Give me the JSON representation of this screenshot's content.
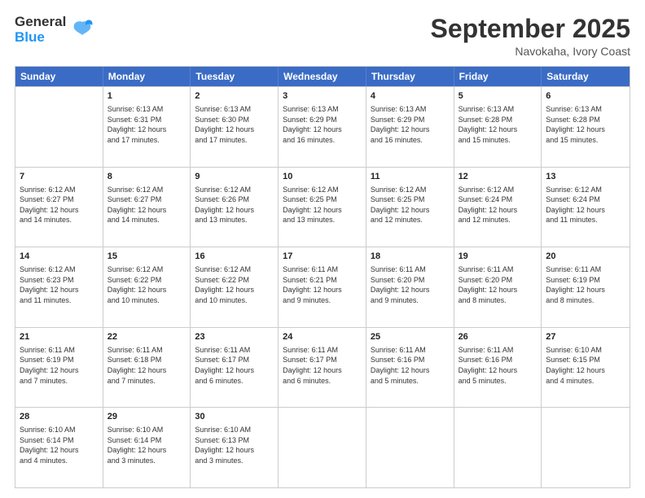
{
  "header": {
    "logo_general": "General",
    "logo_blue": "Blue",
    "month_title": "September 2025",
    "location": "Navokaha, Ivory Coast"
  },
  "calendar": {
    "days": [
      "Sunday",
      "Monday",
      "Tuesday",
      "Wednesday",
      "Thursday",
      "Friday",
      "Saturday"
    ],
    "rows": [
      [
        {
          "day": "",
          "info": ""
        },
        {
          "day": "1",
          "info": "Sunrise: 6:13 AM\nSunset: 6:31 PM\nDaylight: 12 hours\nand 17 minutes."
        },
        {
          "day": "2",
          "info": "Sunrise: 6:13 AM\nSunset: 6:30 PM\nDaylight: 12 hours\nand 17 minutes."
        },
        {
          "day": "3",
          "info": "Sunrise: 6:13 AM\nSunset: 6:29 PM\nDaylight: 12 hours\nand 16 minutes."
        },
        {
          "day": "4",
          "info": "Sunrise: 6:13 AM\nSunset: 6:29 PM\nDaylight: 12 hours\nand 16 minutes."
        },
        {
          "day": "5",
          "info": "Sunrise: 6:13 AM\nSunset: 6:28 PM\nDaylight: 12 hours\nand 15 minutes."
        },
        {
          "day": "6",
          "info": "Sunrise: 6:13 AM\nSunset: 6:28 PM\nDaylight: 12 hours\nand 15 minutes."
        }
      ],
      [
        {
          "day": "7",
          "info": "Sunrise: 6:12 AM\nSunset: 6:27 PM\nDaylight: 12 hours\nand 14 minutes."
        },
        {
          "day": "8",
          "info": "Sunrise: 6:12 AM\nSunset: 6:27 PM\nDaylight: 12 hours\nand 14 minutes."
        },
        {
          "day": "9",
          "info": "Sunrise: 6:12 AM\nSunset: 6:26 PM\nDaylight: 12 hours\nand 13 minutes."
        },
        {
          "day": "10",
          "info": "Sunrise: 6:12 AM\nSunset: 6:25 PM\nDaylight: 12 hours\nand 13 minutes."
        },
        {
          "day": "11",
          "info": "Sunrise: 6:12 AM\nSunset: 6:25 PM\nDaylight: 12 hours\nand 12 minutes."
        },
        {
          "day": "12",
          "info": "Sunrise: 6:12 AM\nSunset: 6:24 PM\nDaylight: 12 hours\nand 12 minutes."
        },
        {
          "day": "13",
          "info": "Sunrise: 6:12 AM\nSunset: 6:24 PM\nDaylight: 12 hours\nand 11 minutes."
        }
      ],
      [
        {
          "day": "14",
          "info": "Sunrise: 6:12 AM\nSunset: 6:23 PM\nDaylight: 12 hours\nand 11 minutes."
        },
        {
          "day": "15",
          "info": "Sunrise: 6:12 AM\nSunset: 6:22 PM\nDaylight: 12 hours\nand 10 minutes."
        },
        {
          "day": "16",
          "info": "Sunrise: 6:12 AM\nSunset: 6:22 PM\nDaylight: 12 hours\nand 10 minutes."
        },
        {
          "day": "17",
          "info": "Sunrise: 6:11 AM\nSunset: 6:21 PM\nDaylight: 12 hours\nand 9 minutes."
        },
        {
          "day": "18",
          "info": "Sunrise: 6:11 AM\nSunset: 6:20 PM\nDaylight: 12 hours\nand 9 minutes."
        },
        {
          "day": "19",
          "info": "Sunrise: 6:11 AM\nSunset: 6:20 PM\nDaylight: 12 hours\nand 8 minutes."
        },
        {
          "day": "20",
          "info": "Sunrise: 6:11 AM\nSunset: 6:19 PM\nDaylight: 12 hours\nand 8 minutes."
        }
      ],
      [
        {
          "day": "21",
          "info": "Sunrise: 6:11 AM\nSunset: 6:19 PM\nDaylight: 12 hours\nand 7 minutes."
        },
        {
          "day": "22",
          "info": "Sunrise: 6:11 AM\nSunset: 6:18 PM\nDaylight: 12 hours\nand 7 minutes."
        },
        {
          "day": "23",
          "info": "Sunrise: 6:11 AM\nSunset: 6:17 PM\nDaylight: 12 hours\nand 6 minutes."
        },
        {
          "day": "24",
          "info": "Sunrise: 6:11 AM\nSunset: 6:17 PM\nDaylight: 12 hours\nand 6 minutes."
        },
        {
          "day": "25",
          "info": "Sunrise: 6:11 AM\nSunset: 6:16 PM\nDaylight: 12 hours\nand 5 minutes."
        },
        {
          "day": "26",
          "info": "Sunrise: 6:11 AM\nSunset: 6:16 PM\nDaylight: 12 hours\nand 5 minutes."
        },
        {
          "day": "27",
          "info": "Sunrise: 6:10 AM\nSunset: 6:15 PM\nDaylight: 12 hours\nand 4 minutes."
        }
      ],
      [
        {
          "day": "28",
          "info": "Sunrise: 6:10 AM\nSunset: 6:14 PM\nDaylight: 12 hours\nand 4 minutes."
        },
        {
          "day": "29",
          "info": "Sunrise: 6:10 AM\nSunset: 6:14 PM\nDaylight: 12 hours\nand 3 minutes."
        },
        {
          "day": "30",
          "info": "Sunrise: 6:10 AM\nSunset: 6:13 PM\nDaylight: 12 hours\nand 3 minutes."
        },
        {
          "day": "",
          "info": ""
        },
        {
          "day": "",
          "info": ""
        },
        {
          "day": "",
          "info": ""
        },
        {
          "day": "",
          "info": ""
        }
      ]
    ]
  }
}
